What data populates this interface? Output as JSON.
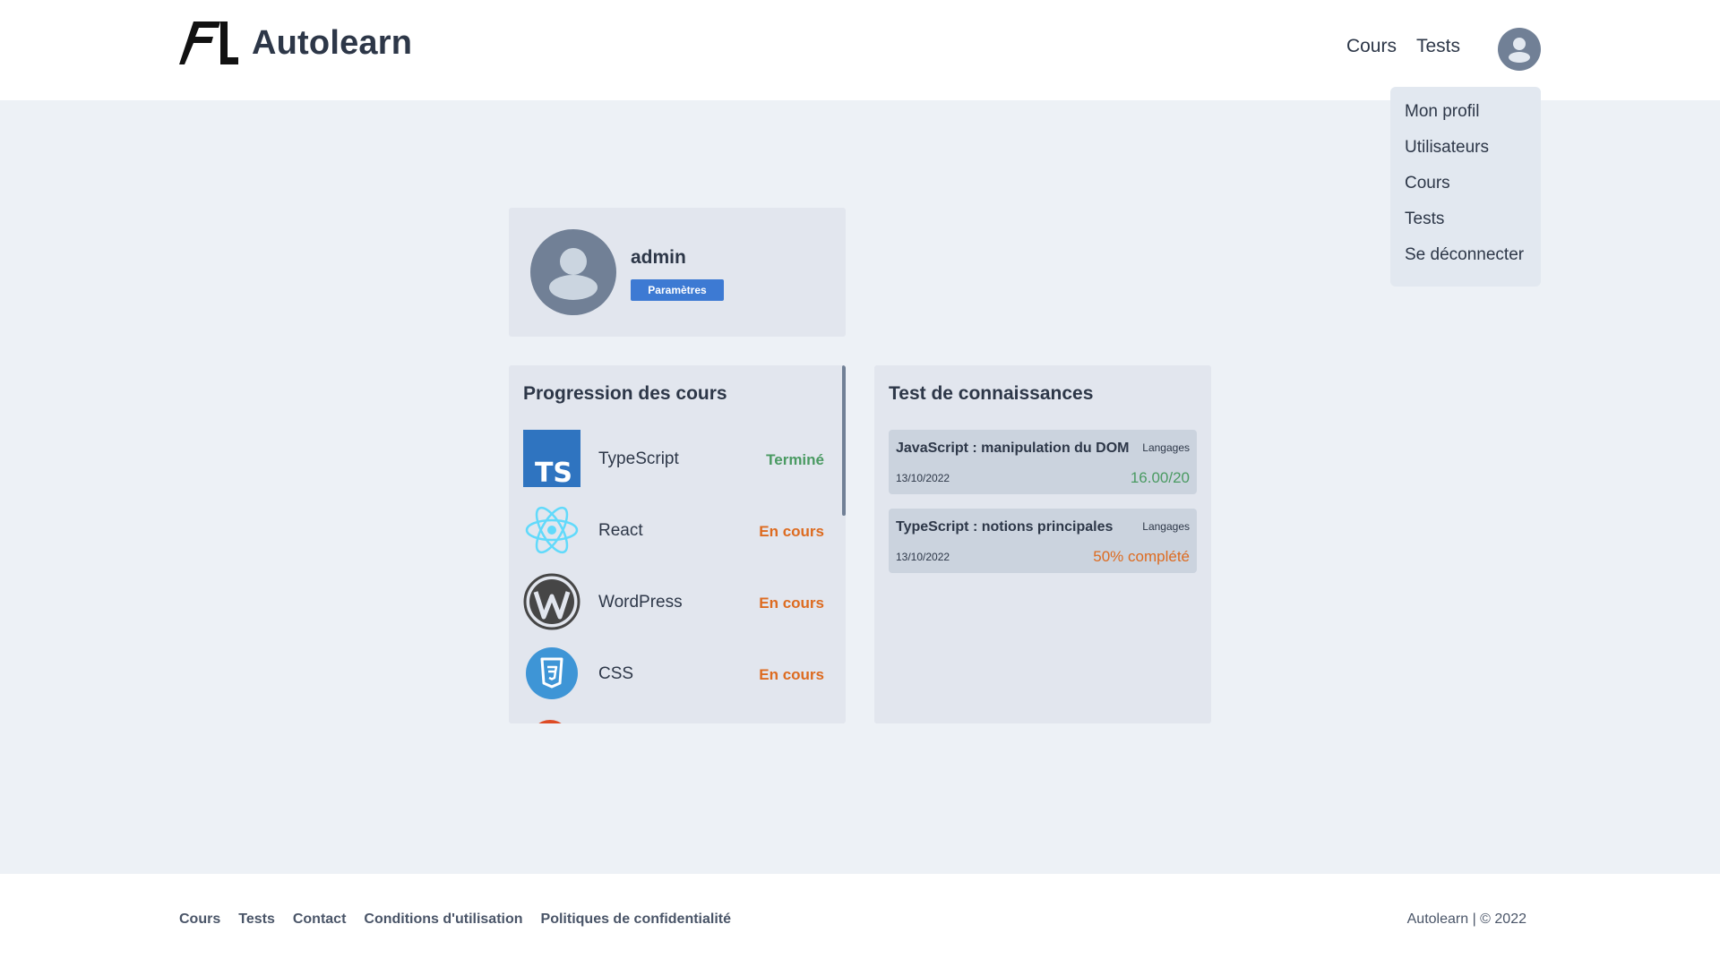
{
  "brand": {
    "name": "Autolearn"
  },
  "nav": {
    "cours": "Cours",
    "tests": "Tests"
  },
  "dropdown": {
    "items": [
      "Mon profil",
      "Utilisateurs",
      "Cours",
      "Tests",
      "Se déconnecter"
    ]
  },
  "profile": {
    "username": "admin",
    "settings_label": "Paramètres"
  },
  "courses": {
    "title": "Progression des cours",
    "items": [
      {
        "name": "TypeScript",
        "status": "Terminé",
        "icon": "typescript-icon"
      },
      {
        "name": "React",
        "status": "En cours",
        "icon": "react-icon"
      },
      {
        "name": "WordPress",
        "status": "En cours",
        "icon": "wordpress-icon"
      },
      {
        "name": "CSS",
        "status": "En cours",
        "icon": "css3-icon"
      }
    ]
  },
  "tests": {
    "title": "Test de connaissances",
    "items": [
      {
        "title": "JavaScript : manipulation du DOM",
        "tag": "Langages",
        "date": "13/10/2022",
        "result": "16.00/20"
      },
      {
        "title": "TypeScript : notions principales",
        "tag": "Langages",
        "date": "13/10/2022",
        "result": "50% complété"
      }
    ]
  },
  "footer": {
    "links": [
      "Cours",
      "Tests",
      "Contact",
      "Conditions d'utilisation",
      "Politiques de confidentialité"
    ],
    "copyright": "Autolearn | © 2022"
  },
  "colors": {
    "accent": "#3d7ad3",
    "done": "#4a9a62",
    "in_progress": "#dd6b20",
    "background": "#edf1f6",
    "card": "#e2e6ee"
  }
}
